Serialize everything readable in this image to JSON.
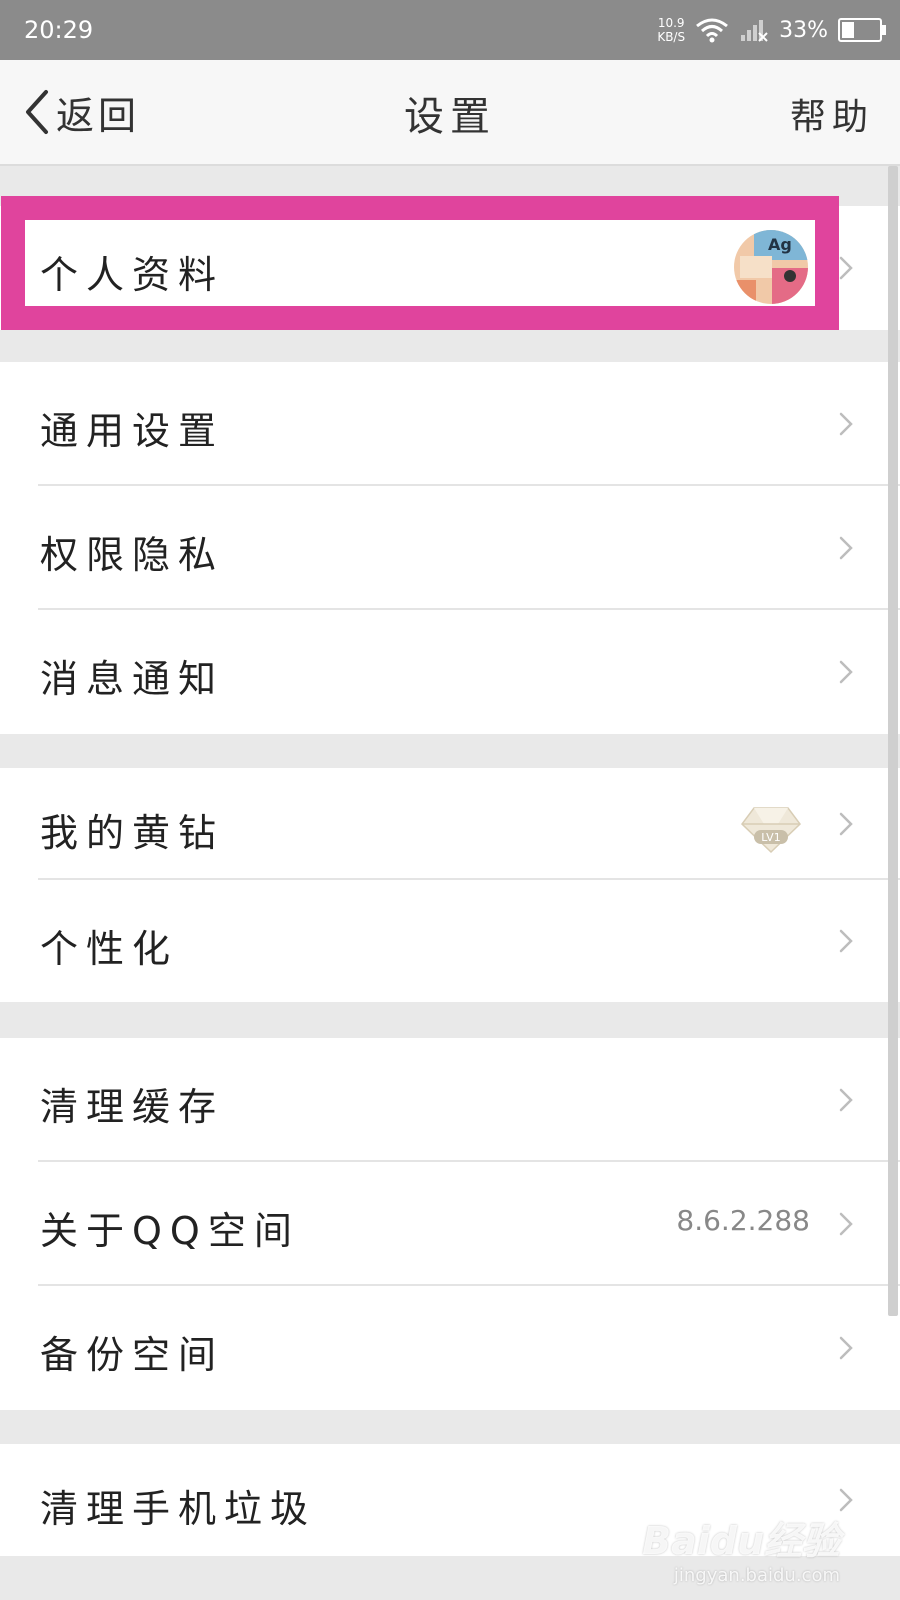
{
  "status_bar": {
    "time": "20:29",
    "net_speed_value": "10.9",
    "net_speed_unit": "KB/S",
    "battery": "33%"
  },
  "nav": {
    "back_label": "返回",
    "title": "设置",
    "help_label": "帮助"
  },
  "sections": {
    "profile": {
      "label": "个人资料"
    },
    "general": {
      "items": [
        {
          "label": "通用设置"
        },
        {
          "label": "权限隐私"
        },
        {
          "label": "消息通知"
        }
      ]
    },
    "vip": {
      "items": [
        {
          "label": "我的黄钻",
          "badge": "LV1"
        },
        {
          "label": "个性化"
        }
      ]
    },
    "storage": {
      "items": [
        {
          "label": "清理缓存"
        },
        {
          "label": "关于QQ空间",
          "value": "8.6.2.288"
        },
        {
          "label": "备份空间"
        }
      ]
    },
    "cleanup": {
      "items": [
        {
          "label": "清理手机垃圾"
        }
      ]
    }
  },
  "watermark": {
    "logo": "Baidu经验",
    "url": "jingyan.baidu.com"
  },
  "colors": {
    "highlight": "#e0449d",
    "status_bar": "#8b8b8b",
    "page_bg": "#e9e9e9"
  },
  "icons": [
    "back-chevron-icon",
    "wifi-icon",
    "signal-icon",
    "battery-icon",
    "chevron-right-icon",
    "diamond-icon"
  ]
}
